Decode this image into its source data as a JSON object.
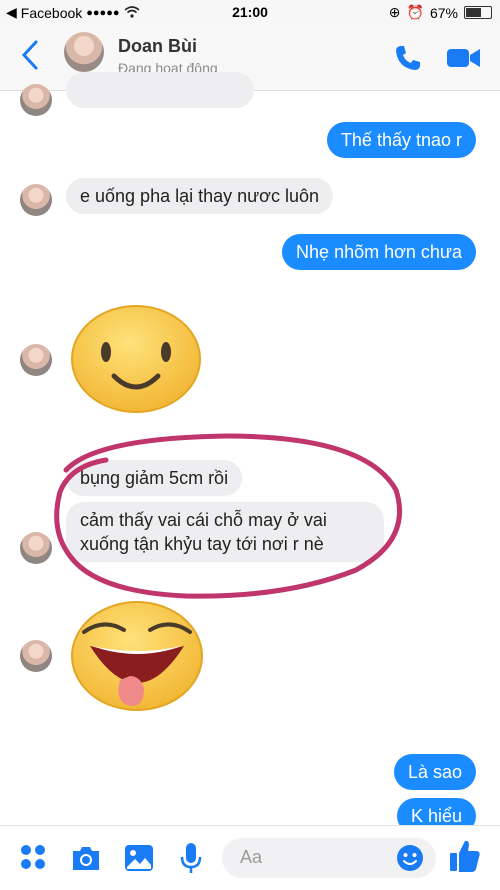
{
  "status_bar": {
    "carrier": "Facebook",
    "signal": "●●●●●",
    "time": "21:00",
    "battery": "67%",
    "battery_level": 0.67
  },
  "header": {
    "contact_name": "Doan Bùi",
    "contact_status": "Đang hoạt động",
    "icons": [
      "back-chevron-icon",
      "phone-icon",
      "video-camera-icon"
    ]
  },
  "messages": [
    {
      "sender": "me",
      "text": "Thế thấy tnao r"
    },
    {
      "sender": "contact",
      "text": "e uống pha lại thay nươc luôn"
    },
    {
      "sender": "me",
      "text": "Nhẹ nhõm hơn chưa"
    },
    {
      "sender": "contact",
      "type": "emoji",
      "emoji": "smiling-face"
    },
    {
      "sender": "contact",
      "text": "bụng giảm 5cm rồi"
    },
    {
      "sender": "contact",
      "text_line1": "cảm thấy vai cái chỗ may ở vai",
      "text_line2": "xuống tận khỷu tay tới nơi r nè"
    },
    {
      "sender": "contact",
      "type": "emoji",
      "emoji": "grinning-tongue-face"
    },
    {
      "sender": "me",
      "text": "Là sao"
    },
    {
      "sender": "me",
      "text": "K hiểu"
    }
  ],
  "annotation": {
    "color": "#c0356b",
    "shape": "hand-drawn circle"
  },
  "composer": {
    "placeholder": "Aa",
    "icons": [
      "apps-grid-icon",
      "camera-icon",
      "image-icon",
      "microphone-icon",
      "emoji-icon",
      "thumbs-up-icon"
    ]
  },
  "colors": {
    "accent": "#1a8cff",
    "incoming_bubble": "#eeeef0"
  }
}
